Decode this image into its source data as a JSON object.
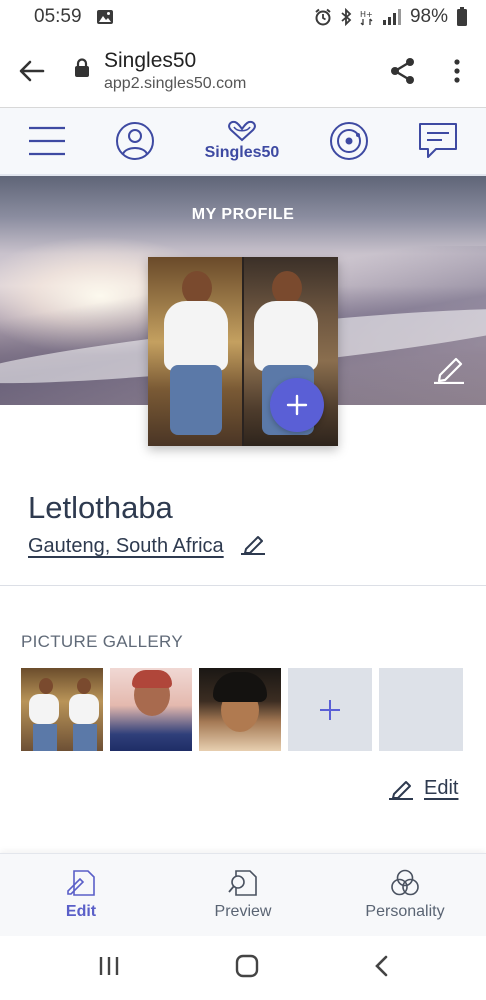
{
  "status_bar": {
    "time": "05:59",
    "battery": "98%",
    "icons": [
      "image-icon",
      "alarm-icon",
      "bluetooth-icon",
      "hplus-icon",
      "signal-icon",
      "battery-icon"
    ]
  },
  "browser": {
    "site_title": "Singles50",
    "site_url": "app2.singles50.com"
  },
  "app_nav": {
    "logo_text": "Singles50",
    "items": [
      "menu-icon",
      "profile-icon",
      "logo",
      "discover-icon",
      "messages-icon"
    ]
  },
  "banner": {
    "title": "MY PROFILE"
  },
  "profile": {
    "name": "Letlothaba",
    "location": "Gauteng, South Africa"
  },
  "gallery": {
    "title": "PICTURE GALLERY",
    "edit_label": "Edit"
  },
  "bottom_tabs": {
    "tabs": [
      {
        "label": "Edit",
        "icon": "edit-doc-icon",
        "active": true
      },
      {
        "label": "Preview",
        "icon": "preview-doc-icon",
        "active": false
      },
      {
        "label": "Personality",
        "icon": "personality-circles-icon",
        "active": false
      }
    ]
  },
  "colors": {
    "accent": "#5a5fd6",
    "nav_icon": "#3e4aa2",
    "text_dark": "#2e3a4f"
  }
}
